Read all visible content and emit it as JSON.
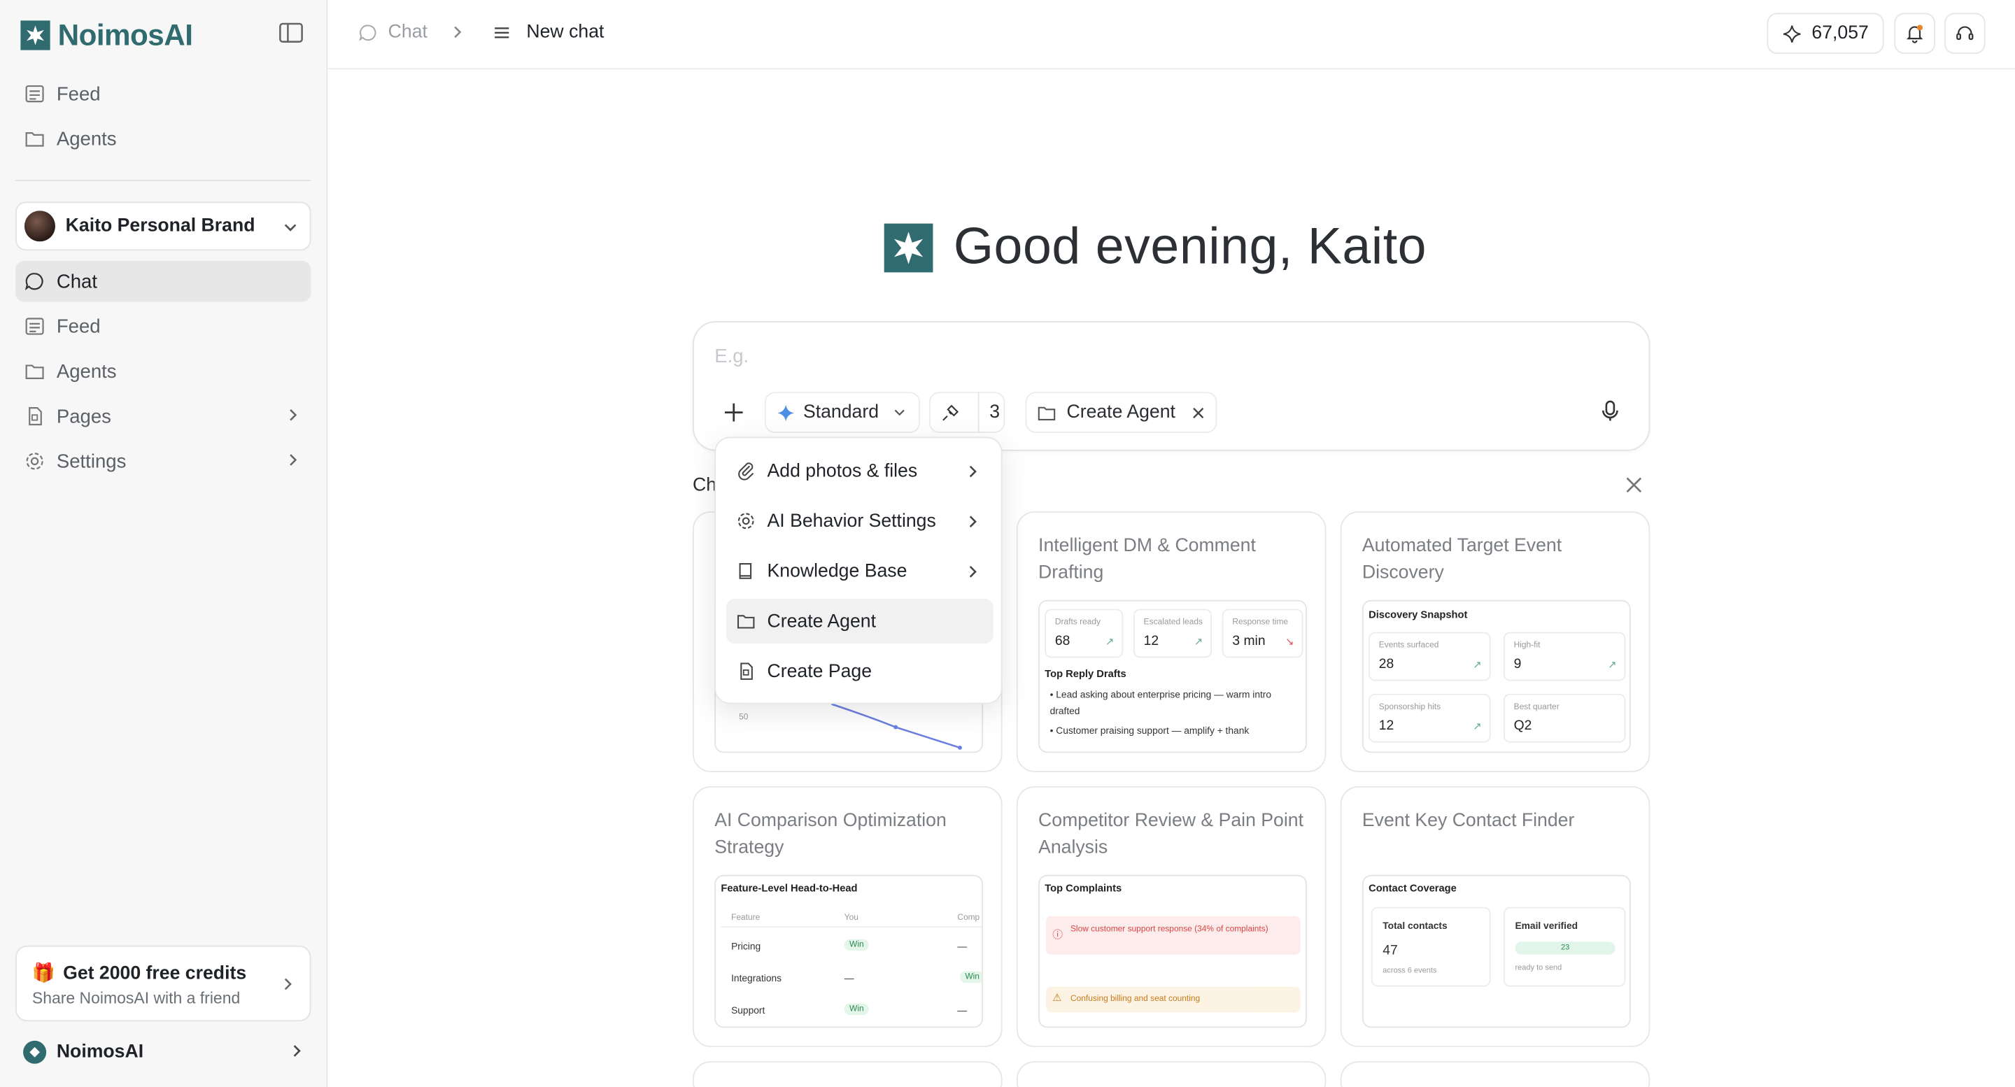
{
  "app": {
    "name": "NoimosAI"
  },
  "sidebar": {
    "top_items": [
      {
        "label": "Feed"
      },
      {
        "label": "Agents"
      }
    ],
    "brand": {
      "name": "Kaito Personal Brand"
    },
    "items": [
      {
        "label": "Chat",
        "active": true
      },
      {
        "label": "Feed"
      },
      {
        "label": "Agents"
      },
      {
        "label": "Pages"
      },
      {
        "label": "Settings"
      }
    ],
    "promo": {
      "title": "Get 2000 free credits",
      "subtitle": "Share NoimosAI with a friend"
    },
    "footer": {
      "label": "NoimosAI"
    }
  },
  "topbar": {
    "breadcrumb": {
      "root": "Chat",
      "current": "New chat"
    },
    "credits": "67,057"
  },
  "greeting": "Good evening, Kaito",
  "composer": {
    "placeholder": "E.g.",
    "mode": "Standard",
    "tools_count": "3",
    "chip": "Create Agent"
  },
  "chips_label": "Ch",
  "menu": {
    "items": [
      {
        "label": "Add photos & files"
      },
      {
        "label": "AI Behavior Settings"
      },
      {
        "label": "Knowledge Base"
      },
      {
        "label": "Create Agent"
      },
      {
        "label": "Create Page"
      }
    ]
  },
  "cards": [
    {
      "title": "Intelligent DM & Comment Drafting",
      "kpis": [
        {
          "label": "Drafts ready",
          "value": "68"
        },
        {
          "label": "Escalated leads",
          "value": "12"
        },
        {
          "label": "Response time",
          "value": "3 min"
        }
      ],
      "section": "Top Reply Drafts",
      "bullets": [
        "Lead asking about enterprise pricing — warm intro drafted",
        "Customer praising support — amplify + thank"
      ]
    },
    {
      "title": "Automated Target Event Discovery",
      "section": "Discovery Snapshot",
      "kpis": [
        {
          "label": "Events surfaced",
          "value": "28"
        },
        {
          "label": "High-fit",
          "value": "9"
        },
        {
          "label": "Sponsorship hits",
          "value": "12"
        },
        {
          "label": "Best quarter",
          "value": "Q2"
        }
      ]
    },
    {
      "title": "AI Comparison Optimization Strategy",
      "section": "Feature-Level Head-to-Head",
      "columns": [
        "Feature",
        "You",
        "Comp"
      ],
      "rows": [
        {
          "feature": "Pricing",
          "you": "Win",
          "comp": "—"
        },
        {
          "feature": "Integrations",
          "you": "—",
          "comp": "Win"
        },
        {
          "feature": "Support",
          "you": "Win",
          "comp": "—"
        }
      ]
    },
    {
      "title": "Competitor Review & Pain Point Analysis",
      "section": "Top Complaints",
      "complaints": [
        "Slow customer support response (34% of complaints)",
        "Confusing billing and seat counting"
      ]
    },
    {
      "title": "Event Key Contact Finder",
      "section": "Contact Coverage",
      "total": {
        "label": "Total contacts",
        "value": "47",
        "note": "across 6 events"
      },
      "verified": {
        "label": "Email verified",
        "value": "23",
        "note": "ready to send"
      }
    },
    {
      "hidden_chart_tick": "50"
    }
  ],
  "colors": {
    "brand": "#2f6b6f",
    "line": "#6b7fe0"
  }
}
